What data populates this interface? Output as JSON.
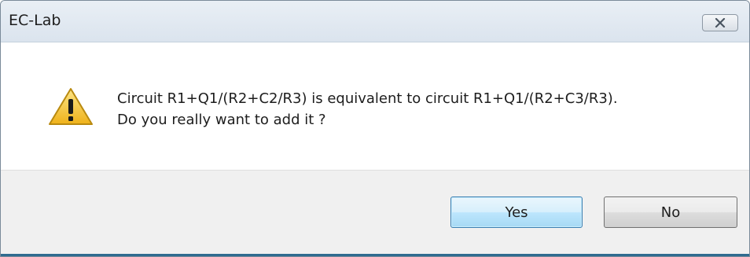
{
  "window": {
    "title": "EC-Lab",
    "close_icon": "close-icon"
  },
  "dialog": {
    "icon": "warning-icon",
    "message_line1": "Circuit R1+Q1/(R2+C2/R3) is equivalent to circuit R1+Q1/(R2+C3/R3).",
    "message_line2": "Do you really want to add it ?"
  },
  "buttons": {
    "yes_label": "Yes",
    "no_label": "No"
  },
  "colors": {
    "title_bar": "#dbe4ee",
    "default_button_border": "#3c7fb1",
    "warning_fill": "#f5c92e"
  }
}
